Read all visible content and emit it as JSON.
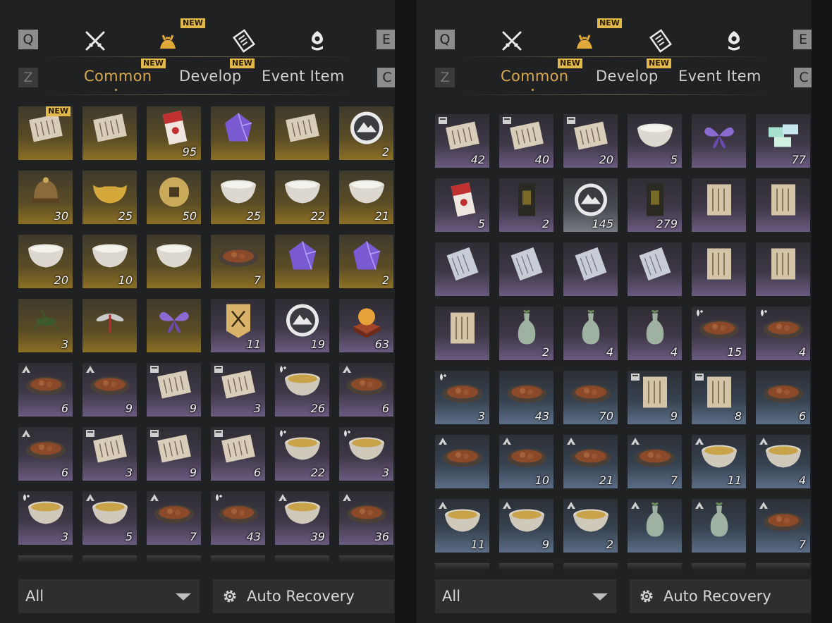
{
  "colors": {
    "accent": "#d9a94f",
    "new_badge": "#e0b94a",
    "gold_tier": "#8c7025",
    "purple_tier": "#6a5a80",
    "blue_tier": "#5b6d86"
  },
  "left": {
    "keys": {
      "prev_cat": "Q",
      "next_cat": "E",
      "prev_tab": "Z",
      "next_tab": "C"
    },
    "new_label": "NEW",
    "tabs": [
      {
        "label": "Common",
        "active": true,
        "new": true
      },
      {
        "label": "Develop",
        "active": false,
        "new": true
      },
      {
        "label": "Event Item",
        "active": false,
        "new": false
      }
    ],
    "items": [
      {
        "icon": "jade-carving-icon",
        "tier": "gold",
        "count": "",
        "new": true
      },
      {
        "icon": "brush-and-paper-icon",
        "tier": "gold",
        "count": ""
      },
      {
        "icon": "red-envelope-icon",
        "tier": "gold",
        "count": "95"
      },
      {
        "icon": "purple-crystal-icon",
        "tier": "gold",
        "count": ""
      },
      {
        "icon": "open-book-icon",
        "tier": "gold",
        "count": ""
      },
      {
        "icon": "medallion-icon",
        "tier": "gold",
        "count": "2"
      },
      {
        "icon": "bronze-helmet-icon",
        "tier": "gold",
        "count": "30"
      },
      {
        "icon": "gold-ingot-icon",
        "tier": "gold",
        "count": "25"
      },
      {
        "icon": "ancient-coin-icon",
        "tier": "gold",
        "count": "50"
      },
      {
        "icon": "porcelain-bowl-icon",
        "tier": "gold",
        "count": "25"
      },
      {
        "icon": "porcelain-bowl-icon",
        "tier": "gold",
        "count": "22"
      },
      {
        "icon": "porcelain-bowl-icon",
        "tier": "gold",
        "count": "21"
      },
      {
        "icon": "rooster-bowl-icon",
        "tier": "gold",
        "count": "20"
      },
      {
        "icon": "porcelain-bowl-icon",
        "tier": "gold",
        "count": "10"
      },
      {
        "icon": "lidded-bowl-icon",
        "tier": "gold",
        "count": ""
      },
      {
        "icon": "plate-icon",
        "tier": "gold",
        "count": "7"
      },
      {
        "icon": "ore-icon",
        "tier": "gold",
        "count": ""
      },
      {
        "icon": "stone-egg-icon",
        "tier": "gold",
        "count": "2"
      },
      {
        "icon": "grasshopper-icon",
        "tier": "gold",
        "count": "3"
      },
      {
        "icon": "dragonfly-icon",
        "tier": "gold",
        "count": ""
      },
      {
        "icon": "purple-butterfly-icon",
        "tier": "gold",
        "count": ""
      },
      {
        "icon": "banner-icon",
        "tier": "purple",
        "count": "11"
      },
      {
        "icon": "mountain-token-icon",
        "tier": "purple",
        "count": "19"
      },
      {
        "icon": "orb-pedestal-icon",
        "tier": "purple",
        "count": "63"
      },
      {
        "icon": "stew-icon",
        "tier": "purple",
        "count": "6",
        "badge": "tent"
      },
      {
        "icon": "meatball-icon",
        "tier": "purple",
        "count": "9",
        "badge": "tent"
      },
      {
        "icon": "recipe-paper-icon",
        "tier": "purple",
        "count": "9",
        "badge": "paper"
      },
      {
        "icon": "recipe-paper-icon",
        "tier": "purple",
        "count": "3",
        "badge": "paper"
      },
      {
        "icon": "steamed-bun-icon",
        "tier": "purple",
        "count": "26",
        "badge": "drop"
      },
      {
        "icon": "omelette-icon",
        "tier": "purple",
        "count": "6",
        "badge": "tent"
      },
      {
        "icon": "gourd-ladle-icon",
        "tier": "purple",
        "count": "6",
        "badge": "tent"
      },
      {
        "icon": "recipe-paper-icon",
        "tier": "purple",
        "count": "3",
        "badge": "paper"
      },
      {
        "icon": "recipe-paper-icon",
        "tier": "purple",
        "count": "9",
        "badge": "paper"
      },
      {
        "icon": "recipe-paper-icon",
        "tier": "purple",
        "count": "6",
        "badge": "paper"
      },
      {
        "icon": "soup-bowl-icon",
        "tier": "purple",
        "count": "22",
        "badge": "drop"
      },
      {
        "icon": "soup-bowl-icon",
        "tier": "purple",
        "count": "3",
        "badge": "drop"
      },
      {
        "icon": "soup-bowl-icon",
        "tier": "purple",
        "count": "3",
        "badge": "drop"
      },
      {
        "icon": "clay-pot-icon",
        "tier": "purple",
        "count": "5",
        "badge": "tent"
      },
      {
        "icon": "noodle-dish-icon",
        "tier": "purple",
        "count": "7",
        "badge": "tent"
      },
      {
        "icon": "stew-icon",
        "tier": "purple",
        "count": "43",
        "badge": "drop"
      },
      {
        "icon": "clay-pot-icon",
        "tier": "purple",
        "count": "39",
        "badge": "tent"
      },
      {
        "icon": "dumpling-plate-icon",
        "tier": "purple",
        "count": "36",
        "badge": "tent"
      }
    ],
    "filter_label": "All",
    "auto_label": "Auto Recovery"
  },
  "right": {
    "keys": {
      "prev_cat": "Q",
      "next_cat": "E",
      "prev_tab": "Z",
      "next_tab": "C"
    },
    "new_label": "NEW",
    "tabs": [
      {
        "label": "Common",
        "active": true,
        "new": true
      },
      {
        "label": "Develop",
        "active": false,
        "new": true
      },
      {
        "label": "Event Item",
        "active": false,
        "new": false
      }
    ],
    "items": [
      {
        "icon": "recipe-paper-icon",
        "tier": "purple",
        "count": "42",
        "badge": "paper"
      },
      {
        "icon": "recipe-paper-icon",
        "tier": "purple",
        "count": "40",
        "badge": "paper"
      },
      {
        "icon": "recipe-paper-icon",
        "tier": "purple",
        "count": "20",
        "badge": "paper"
      },
      {
        "icon": "nuts-bowl-icon",
        "tier": "purple",
        "count": "5"
      },
      {
        "icon": "bead-string-icon",
        "tier": "purple",
        "count": ""
      },
      {
        "icon": "gift-boxes-icon",
        "tier": "purple",
        "count": "77"
      },
      {
        "icon": "red-envelope-icon",
        "tier": "purple",
        "count": "5"
      },
      {
        "icon": "black-talisman-icon",
        "tier": "purple",
        "count": "2"
      },
      {
        "icon": "crane-token-icon",
        "tier": "white",
        "count": "145"
      },
      {
        "icon": "gold-talisman-icon",
        "tier": "purple",
        "count": "279"
      },
      {
        "icon": "letter-icon",
        "tier": "purple",
        "count": ""
      },
      {
        "icon": "letter-icon",
        "tier": "purple",
        "count": ""
      },
      {
        "icon": "blue-letter-icon",
        "tier": "purple",
        "count": ""
      },
      {
        "icon": "blue-letter-icon",
        "tier": "purple",
        "count": ""
      },
      {
        "icon": "blue-letter-icon",
        "tier": "purple",
        "count": ""
      },
      {
        "icon": "blue-letter-icon",
        "tier": "purple",
        "count": ""
      },
      {
        "icon": "letter-icon",
        "tier": "purple",
        "count": ""
      },
      {
        "icon": "scroll-map-icon",
        "tier": "purple",
        "count": ""
      },
      {
        "icon": "scroll-map-icon",
        "tier": "purple",
        "count": ""
      },
      {
        "icon": "celadon-vase-icon",
        "tier": "purple",
        "count": "2"
      },
      {
        "icon": "celadon-vase-icon",
        "tier": "purple",
        "count": "4"
      },
      {
        "icon": "celadon-vase-icon",
        "tier": "purple",
        "count": "4"
      },
      {
        "icon": "egg-plate-icon",
        "tier": "purple",
        "count": "15",
        "badge": "drop"
      },
      {
        "icon": "sliced-meat-icon",
        "tier": "purple",
        "count": "4",
        "badge": "drop"
      },
      {
        "icon": "cucumber-plate-icon",
        "tier": "blue",
        "count": "3",
        "badge": "drop"
      },
      {
        "icon": "roast-meat-icon",
        "tier": "blue",
        "count": "43"
      },
      {
        "icon": "grilled-meat-icon",
        "tier": "blue",
        "count": "70"
      },
      {
        "icon": "landscape-scroll-icon",
        "tier": "blue",
        "count": "9",
        "badge": "paper"
      },
      {
        "icon": "landscape-scroll-icon",
        "tier": "blue",
        "count": "8",
        "badge": "paper"
      },
      {
        "icon": "chestnuts-icon",
        "tier": "blue",
        "count": "6"
      },
      {
        "icon": "tofu-plate-icon",
        "tier": "blue",
        "count": "",
        "badge": "tent"
      },
      {
        "icon": "crispy-cake-icon",
        "tier": "blue",
        "count": "10",
        "badge": "tent"
      },
      {
        "icon": "fried-fish-icon",
        "tier": "blue",
        "count": "21",
        "badge": "tent"
      },
      {
        "icon": "greens-plate-icon",
        "tier": "blue",
        "count": "7",
        "badge": "tent"
      },
      {
        "icon": "soup-bowl-icon",
        "tier": "blue",
        "count": "11",
        "badge": "tent"
      },
      {
        "icon": "soup-bowl-icon",
        "tier": "blue",
        "count": "4",
        "badge": "tent"
      },
      {
        "icon": "tea-bowl-icon",
        "tier": "blue",
        "count": "11",
        "badge": "tent"
      },
      {
        "icon": "porridge-bowl-icon",
        "tier": "blue",
        "count": "9",
        "badge": "tent"
      },
      {
        "icon": "rice-bowl-icon",
        "tier": "blue",
        "count": "2",
        "badge": "tent"
      },
      {
        "icon": "blue-vase-icon",
        "tier": "blue",
        "count": "",
        "badge": "tent"
      },
      {
        "icon": "gourd-bottle-icon",
        "tier": "blue",
        "count": "",
        "badge": "tent"
      },
      {
        "icon": "noodle-dish-icon",
        "tier": "blue",
        "count": "7",
        "badge": "tent"
      }
    ],
    "filter_label": "All",
    "auto_label": "Auto Recovery"
  }
}
